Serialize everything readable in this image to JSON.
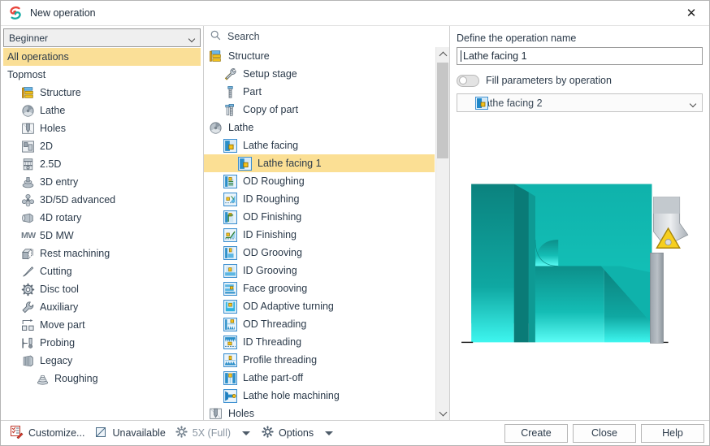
{
  "window": {
    "title": "New operation",
    "app_icon": "app-logo-icon",
    "close_label": "✕"
  },
  "left_panel": {
    "mode_combo": {
      "value": "Beginner",
      "icon": "chevron-down-icon"
    },
    "items": [
      {
        "label": "All operations",
        "icon": "none",
        "indent": 0,
        "selected": true
      },
      {
        "label": "Topmost",
        "icon": "none",
        "indent": 0,
        "selected": false
      },
      {
        "label": "Structure",
        "icon": "structure-icon",
        "indent": 1,
        "selected": false
      },
      {
        "label": "Lathe",
        "icon": "lathe-icon",
        "indent": 1,
        "selected": false
      },
      {
        "label": "Holes",
        "icon": "holes-icon",
        "indent": 1,
        "selected": false
      },
      {
        "label": "2D",
        "icon": "twod-icon",
        "indent": 1,
        "selected": false
      },
      {
        "label": "2.5D",
        "icon": "twofived-icon",
        "indent": 1,
        "selected": false
      },
      {
        "label": "3D entry",
        "icon": "threed-entry-icon",
        "indent": 1,
        "selected": false
      },
      {
        "label": "3D/5D advanced",
        "icon": "threed-fived-advanced-icon",
        "indent": 1,
        "selected": false
      },
      {
        "label": "4D rotary",
        "icon": "fourd-rotary-icon",
        "indent": 1,
        "selected": false
      },
      {
        "label": "5D MW",
        "icon": "fived-mw-icon",
        "indent": 1,
        "selected": false
      },
      {
        "label": "Rest machining",
        "icon": "rest-machining-icon",
        "indent": 1,
        "selected": false
      },
      {
        "label": "Cutting",
        "icon": "cutting-icon",
        "indent": 1,
        "selected": false
      },
      {
        "label": "Disc tool",
        "icon": "disc-tool-icon",
        "indent": 1,
        "selected": false
      },
      {
        "label": "Auxiliary",
        "icon": "auxiliary-icon",
        "indent": 1,
        "selected": false
      },
      {
        "label": "Move part",
        "icon": "move-part-icon",
        "indent": 1,
        "selected": false
      },
      {
        "label": "Probing",
        "icon": "probing-icon",
        "indent": 1,
        "selected": false
      },
      {
        "label": "Legacy",
        "icon": "legacy-icon",
        "indent": 1,
        "selected": false
      },
      {
        "label": "Roughing",
        "icon": "roughing-icon",
        "indent": 2,
        "selected": false
      }
    ]
  },
  "middle_panel": {
    "search": {
      "placeholder": "Search",
      "value": "",
      "icon": "search-icon"
    },
    "tree": [
      {
        "label": "Structure",
        "icon": "structure-icon",
        "level": 0,
        "selected": false
      },
      {
        "label": "Setup stage",
        "icon": "setup-stage-icon",
        "level": 1,
        "selected": false
      },
      {
        "label": "Part",
        "icon": "part-icon",
        "level": 1,
        "selected": false
      },
      {
        "label": "Copy of part",
        "icon": "copy-of-part-icon",
        "level": 1,
        "selected": false
      },
      {
        "label": "Lathe",
        "icon": "lathe-icon",
        "level": 0,
        "selected": false
      },
      {
        "label": "Lathe facing",
        "icon": "lathe-facing-icon",
        "level": 1,
        "selected": false
      },
      {
        "label": "Lathe facing 1",
        "icon": "lathe-facing-icon",
        "level": 2,
        "selected": true
      },
      {
        "label": "OD Roughing",
        "icon": "od-roughing-icon",
        "level": 1,
        "selected": false
      },
      {
        "label": "ID Roughing",
        "icon": "id-roughing-icon",
        "level": 1,
        "selected": false
      },
      {
        "label": "OD Finishing",
        "icon": "od-finishing-icon",
        "level": 1,
        "selected": false
      },
      {
        "label": "ID Finishing",
        "icon": "id-finishing-icon",
        "level": 1,
        "selected": false
      },
      {
        "label": "OD Grooving",
        "icon": "od-grooving-icon",
        "level": 1,
        "selected": false
      },
      {
        "label": "ID Grooving",
        "icon": "id-grooving-icon",
        "level": 1,
        "selected": false
      },
      {
        "label": "Face grooving",
        "icon": "face-grooving-icon",
        "level": 1,
        "selected": false
      },
      {
        "label": "OD Adaptive turning",
        "icon": "od-adaptive-turning-icon",
        "level": 1,
        "selected": false
      },
      {
        "label": "OD Threading",
        "icon": "od-threading-icon",
        "level": 1,
        "selected": false
      },
      {
        "label": "ID Threading",
        "icon": "id-threading-icon",
        "level": 1,
        "selected": false
      },
      {
        "label": "Profile threading",
        "icon": "profile-threading-icon",
        "level": 1,
        "selected": false
      },
      {
        "label": "Lathe part-off",
        "icon": "lathe-part-off-icon",
        "level": 1,
        "selected": false
      },
      {
        "label": "Lathe hole machining",
        "icon": "lathe-hole-machining-icon",
        "level": 1,
        "selected": false
      },
      {
        "label": "Holes",
        "icon": "holes-icon",
        "level": 0,
        "selected": false
      }
    ],
    "scrollbar": {
      "up_icon": "scroll-up-icon",
      "down_icon": "scroll-down-icon"
    }
  },
  "right_panel": {
    "name_label": "Define the operation name",
    "name_value": "Lathe facing 1",
    "fill_toggle": {
      "label": "Fill parameters by operation",
      "state": "off"
    },
    "source_operation": {
      "value": "Lathe facing 2",
      "icon": "lathe-facing-icon",
      "caret": "chevron-down-icon"
    },
    "preview": {
      "name": "lathe-operation-preview",
      "part_color": "#0fb2ab",
      "highlight_color": "#27f4ef"
    }
  },
  "footer": {
    "customize": {
      "label": "Customize...",
      "icon": "customize-icon"
    },
    "unavailable": {
      "label": "Unavailable",
      "icon": "unavailable-icon"
    },
    "mode": {
      "label": "5X (Full)",
      "icon": "gear-icon"
    },
    "mode_caret": "chevron-down-icon",
    "options": {
      "label": "Options",
      "icon": "gear-icon"
    },
    "options_caret": "chevron-down-icon",
    "buttons": [
      {
        "label": "Create",
        "name": "create-button"
      },
      {
        "label": "Close",
        "name": "close-button"
      },
      {
        "label": "Help",
        "name": "help-button"
      }
    ]
  },
  "colors": {
    "selection": "#fbdf94",
    "teal": "#0fb2ab",
    "cyan": "#27f4ef",
    "accent_blue": "#3c8fd0"
  }
}
